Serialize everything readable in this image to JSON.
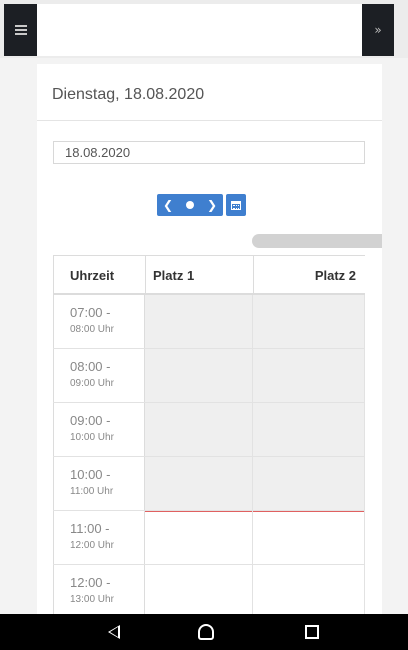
{
  "header": {
    "menu_icon": "hamburger-icon",
    "collapse_icon": "double-chevron-down-icon"
  },
  "card": {
    "title": "Dienstag, 18.08.2020",
    "date_value": "18.08.2020"
  },
  "nav_buttons": {
    "prev_icon": "chevron-left-icon",
    "today_icon": "dot-icon",
    "next_icon": "chevron-right-icon",
    "calendar_icon": "calendar-icon",
    "accent": "#3f7fcf"
  },
  "schedule": {
    "columns": [
      "Uhrzeit",
      "Platz 1",
      "Platz 2"
    ],
    "rows": [
      {
        "start": "07:00 -",
        "end": "08:00 Uhr"
      },
      {
        "start": "08:00 -",
        "end": "09:00 Uhr"
      },
      {
        "start": "09:00 -",
        "end": "10:00 Uhr"
      },
      {
        "start": "10:00 -",
        "end": "11:00 Uhr"
      },
      {
        "start": "11:00 -",
        "end": "12:00 Uhr"
      },
      {
        "start": "12:00 -",
        "end": "13:00 Uhr"
      }
    ],
    "current_time_line_color": "#e06060"
  },
  "android_nav": {
    "back_icon": "back-triangle-icon",
    "home_icon": "home-icon",
    "recents_icon": "recents-square-icon"
  }
}
